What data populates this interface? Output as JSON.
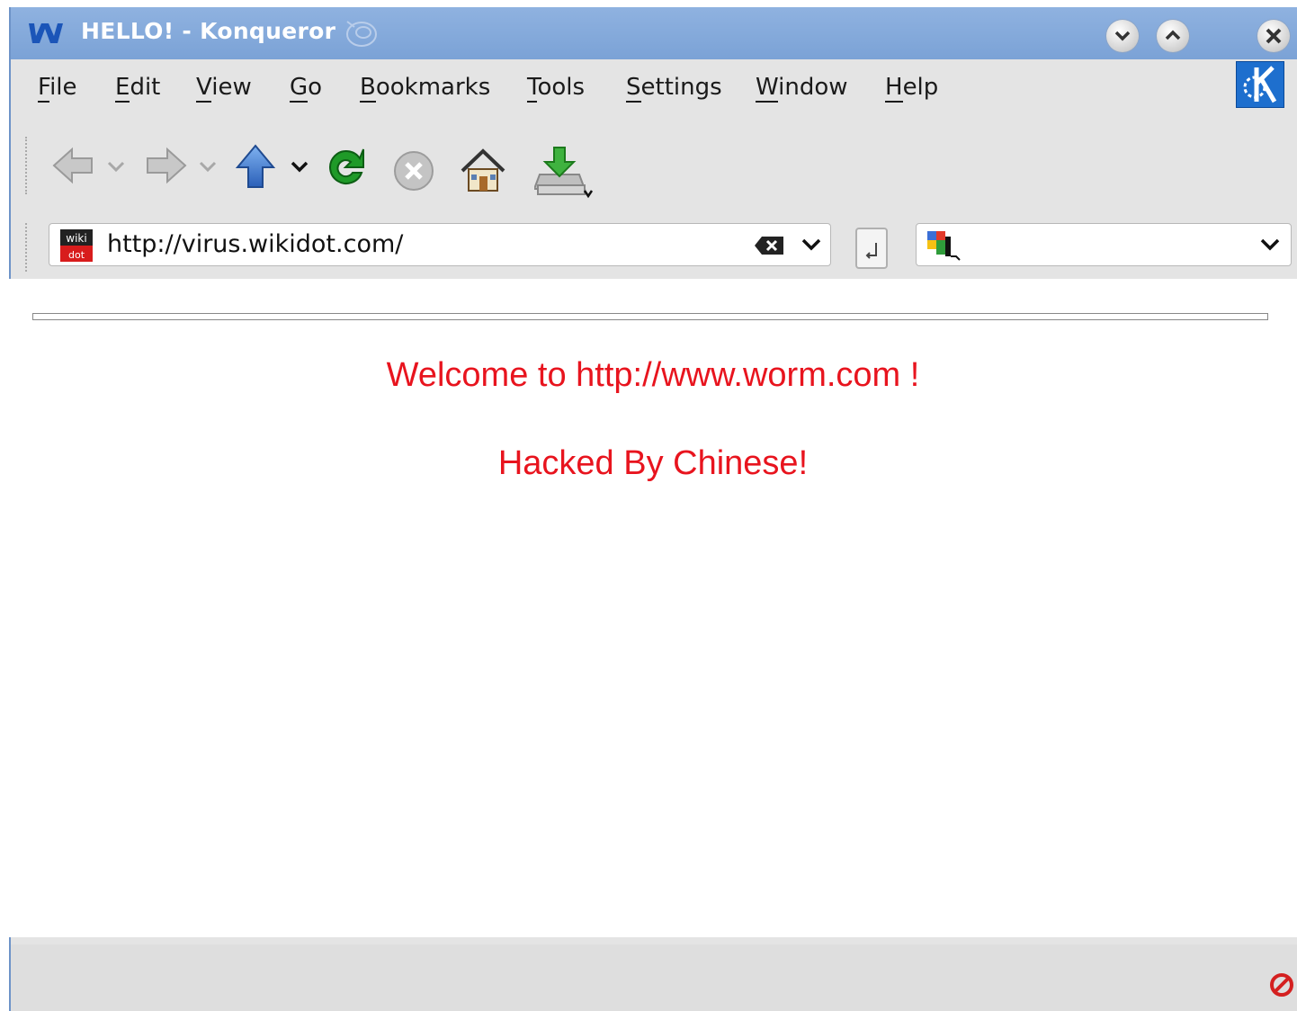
{
  "window": {
    "title": "HELLO! - Konqueror",
    "title_bar_color": "#7ba2d6"
  },
  "menu": {
    "items": [
      {
        "label": "File",
        "mnemonic": "F",
        "rest": "ile"
      },
      {
        "label": "Edit",
        "mnemonic": "E",
        "rest": "dit"
      },
      {
        "label": "View",
        "mnemonic": "V",
        "rest": "iew"
      },
      {
        "label": "Go",
        "mnemonic": "G",
        "rest": "o"
      },
      {
        "label": "Bookmarks",
        "mnemonic": "B",
        "rest": "ookmarks"
      },
      {
        "label": "Tools",
        "mnemonic": "T",
        "rest": "ools"
      },
      {
        "label": "Settings",
        "mnemonic": "S",
        "rest": "ettings"
      },
      {
        "label": "Window",
        "mnemonic": "W",
        "rest": "indow"
      },
      {
        "label": "Help",
        "mnemonic": "H",
        "rest": "elp"
      }
    ]
  },
  "toolbar": {
    "icons": [
      "back-arrow-icon",
      "forward-arrow-icon",
      "up-arrow-icon",
      "reload-icon",
      "stop-icon",
      "home-icon",
      "download-icon"
    ]
  },
  "location": {
    "url": "http://virus.wikidot.com/",
    "favicon": "wikidot-favicon-icon"
  },
  "search": {
    "value": "",
    "engine_icon": "google-search-engine-icon"
  },
  "page": {
    "line1": "Welcome to http://www.worm.com !",
    "line2": "Hacked By Chinese!",
    "text_color": "#e8141e"
  }
}
